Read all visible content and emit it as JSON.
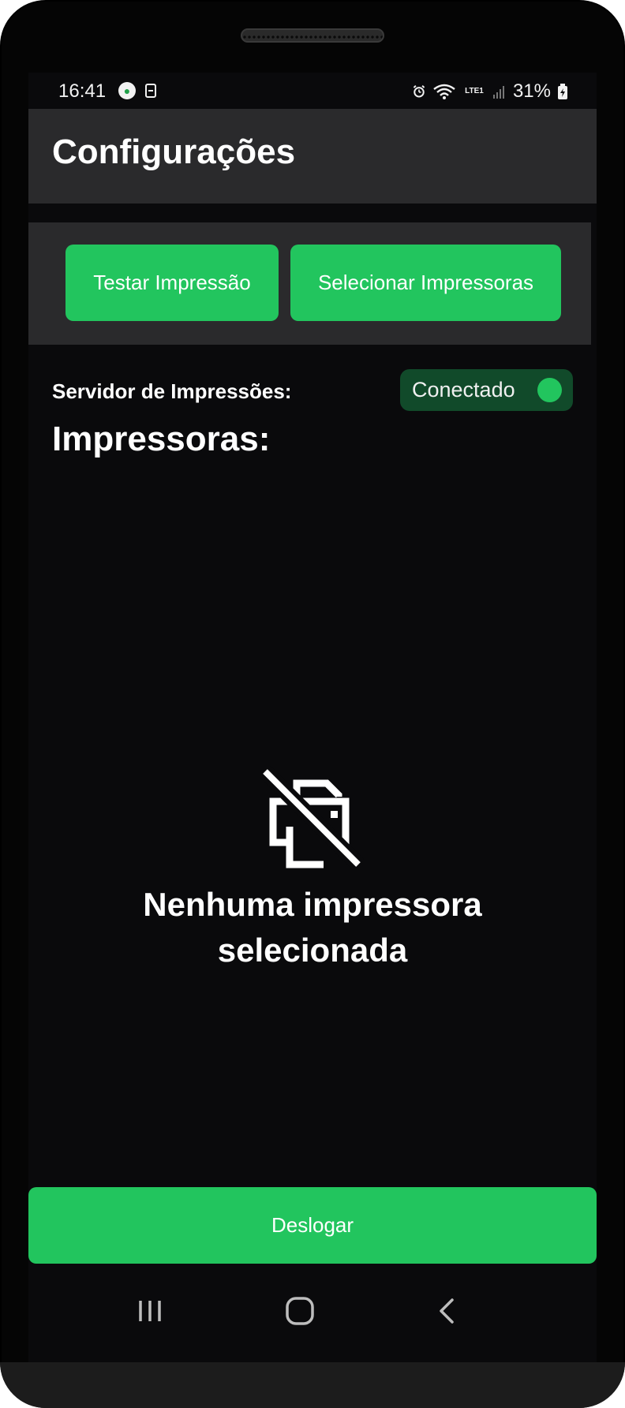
{
  "status_bar": {
    "time": "16:41",
    "battery": "31%",
    "network": "LTE1",
    "icons": [
      "app-notification-icon",
      "sim-card-icon",
      "alarm-icon",
      "wifi-icon",
      "signal-icon",
      "battery-charging-icon"
    ]
  },
  "header": {
    "title": "Configurações"
  },
  "toolbar": {
    "test_print_label": "Testar Impressão",
    "select_printers_label": "Selecionar Impressoras"
  },
  "server": {
    "label": "Servidor de Impressões:",
    "status": "Conectado",
    "connected": true
  },
  "printers": {
    "section_title": "Impressoras:",
    "empty_icon": "printer-off-icon",
    "empty_message_line1": "Nenhuma impressora",
    "empty_message_line2": "selecionada"
  },
  "footer": {
    "logout_label": "Deslogar"
  },
  "navbar": {
    "items": [
      "recent-apps-icon",
      "home-icon",
      "back-icon"
    ]
  },
  "colors": {
    "accent": "#22c55e",
    "accent_dark": "#114a2a",
    "background": "#0a0a0c",
    "surface": "#2a2a2c",
    "text": "#ffffff"
  }
}
